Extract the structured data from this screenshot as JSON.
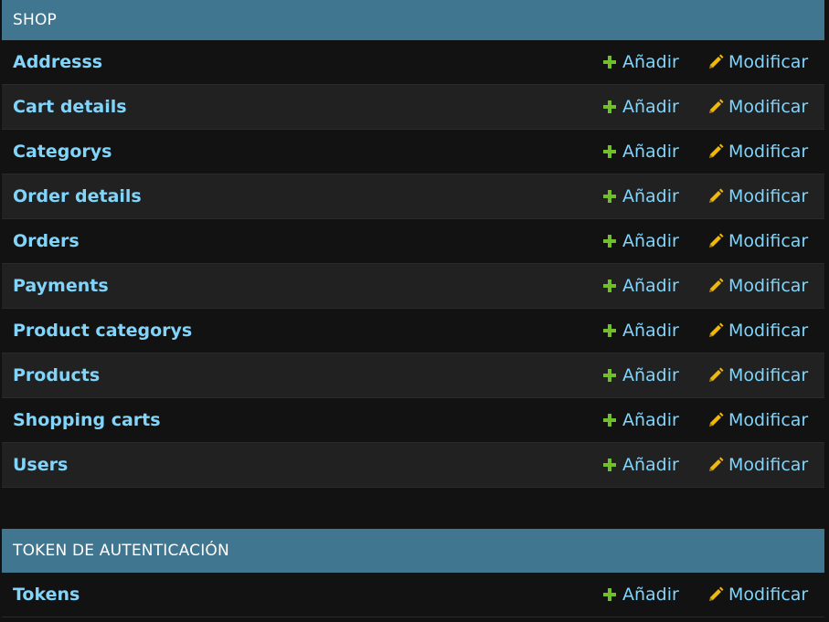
{
  "colors": {
    "header_bg": "#417690",
    "link": "#81d4fa",
    "add_icon": "#70bf2b",
    "change_icon": "#efb80b",
    "row_odd": "#121212",
    "row_even": "#212121"
  },
  "modules": [
    {
      "caption": "SHOP",
      "models": [
        {
          "name": "Addresss",
          "add_label": "Añadir",
          "change_label": "Modificar"
        },
        {
          "name": "Cart details",
          "add_label": "Añadir",
          "change_label": "Modificar"
        },
        {
          "name": "Categorys",
          "add_label": "Añadir",
          "change_label": "Modificar"
        },
        {
          "name": "Order details",
          "add_label": "Añadir",
          "change_label": "Modificar"
        },
        {
          "name": "Orders",
          "add_label": "Añadir",
          "change_label": "Modificar"
        },
        {
          "name": "Payments",
          "add_label": "Añadir",
          "change_label": "Modificar"
        },
        {
          "name": "Product categorys",
          "add_label": "Añadir",
          "change_label": "Modificar"
        },
        {
          "name": "Products",
          "add_label": "Añadir",
          "change_label": "Modificar"
        },
        {
          "name": "Shopping carts",
          "add_label": "Añadir",
          "change_label": "Modificar"
        },
        {
          "name": "Users",
          "add_label": "Añadir",
          "change_label": "Modificar"
        }
      ]
    },
    {
      "caption": "TOKEN DE AUTENTICACIÓN",
      "models": [
        {
          "name": "Tokens",
          "add_label": "Añadir",
          "change_label": "Modificar"
        }
      ]
    }
  ],
  "icons": {
    "add": "plus-icon",
    "change": "pencil-icon"
  }
}
